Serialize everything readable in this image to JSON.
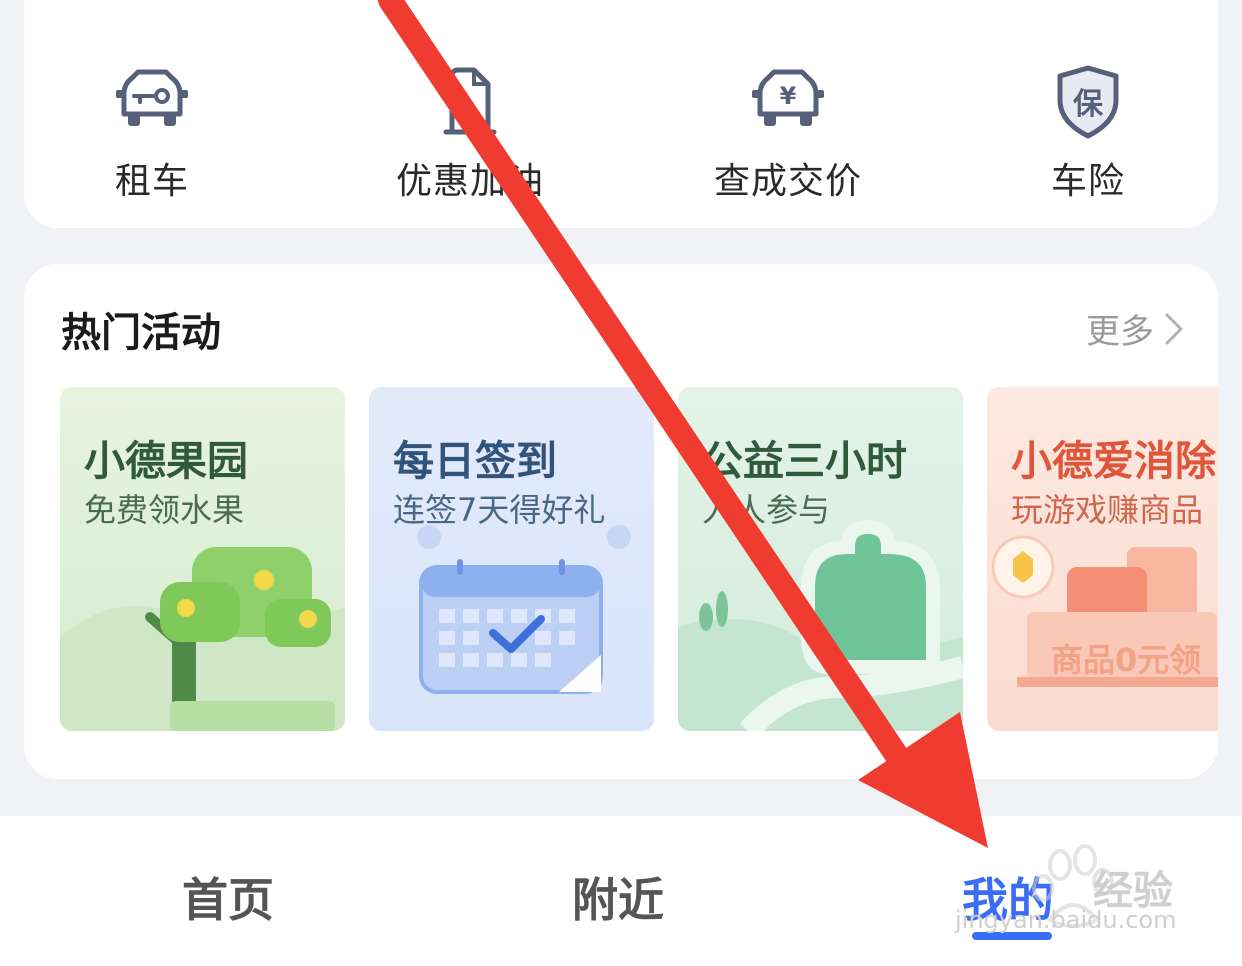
{
  "services": [
    {
      "label": "租车",
      "icon": "car-key-icon"
    },
    {
      "label": "优惠加油",
      "icon": "fuel-coupon-icon"
    },
    {
      "label": "查成交价",
      "icon": "car-price-icon"
    },
    {
      "label": "车险",
      "icon": "insurance-shield-icon"
    }
  ],
  "activities": {
    "title": "热门活动",
    "more": "更多",
    "tiles": [
      {
        "title": "小德果园",
        "subtitle": "免费领水果"
      },
      {
        "title": "每日签到",
        "subtitle": "连签7天得好礼"
      },
      {
        "title": "公益三小时",
        "subtitle": "人人参与"
      },
      {
        "title": "小德爱消除",
        "subtitle": "玩游戏赚商品",
        "badge": "商品0元领"
      }
    ]
  },
  "tabbar": {
    "tabs": [
      {
        "label": "首页",
        "active": false
      },
      {
        "label": "附近",
        "active": false
      },
      {
        "label": "我的",
        "active": true
      }
    ]
  },
  "watermark": {
    "brand": "经验",
    "url": "jingyan.baidu.com"
  },
  "colors": {
    "accent": "#3b6cf6",
    "arrow": "#ef3b30",
    "icon": "#56607a",
    "tile_green": "#2f5a3b",
    "tile_blue": "#33547a",
    "tile_orange": "#e0563b"
  }
}
